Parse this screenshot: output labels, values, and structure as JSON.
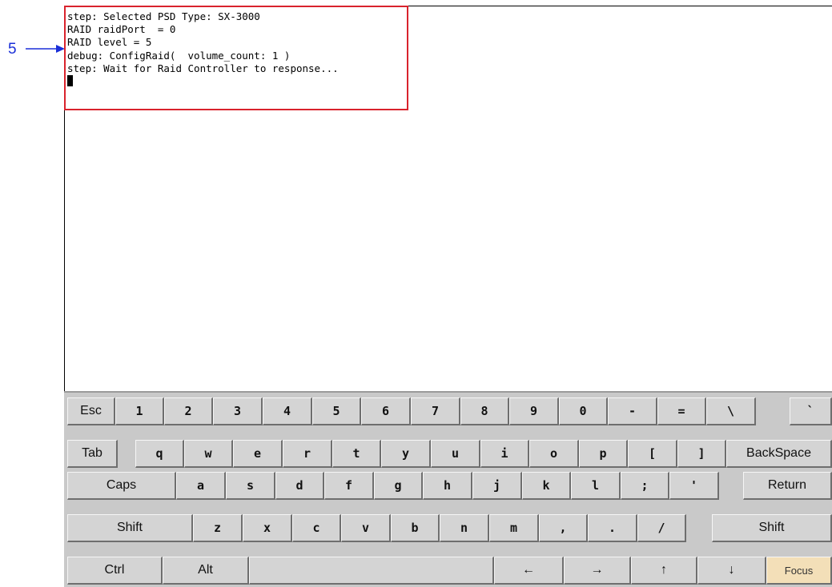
{
  "annotation": {
    "number": "5"
  },
  "terminal": {
    "lines": [
      "step: Selected PSD Type: SX-3000",
      "RAID raidPort  = 0",
      "RAID level = 5",
      "debug: ConfigRaid(  volume_count: 1 )",
      "step: Wait for Raid Controller to response..."
    ]
  },
  "keyboard": {
    "row1": [
      "Esc",
      "1",
      "2",
      "3",
      "4",
      "5",
      "6",
      "7",
      "8",
      "9",
      "0",
      "-",
      "=",
      "\\",
      "`"
    ],
    "row2": [
      "Tab",
      "q",
      "w",
      "e",
      "r",
      "t",
      "y",
      "u",
      "i",
      "o",
      "p",
      "[",
      "]",
      "BackSpace"
    ],
    "row3": [
      "Caps",
      "a",
      "s",
      "d",
      "f",
      "g",
      "h",
      "j",
      "k",
      "l",
      ";",
      "'",
      "Return"
    ],
    "row4": [
      "Shift",
      "z",
      "x",
      "c",
      "v",
      "b",
      "n",
      "m",
      ",",
      ".",
      "/",
      "Shift"
    ],
    "row5": [
      "Ctrl",
      "Alt",
      "",
      "←",
      "→",
      "↑",
      "↓",
      "Focus"
    ]
  },
  "colors": {
    "highlight": "#d9232d",
    "annotation": "#1a2fd8",
    "focus_key": "#f3dfb8"
  }
}
